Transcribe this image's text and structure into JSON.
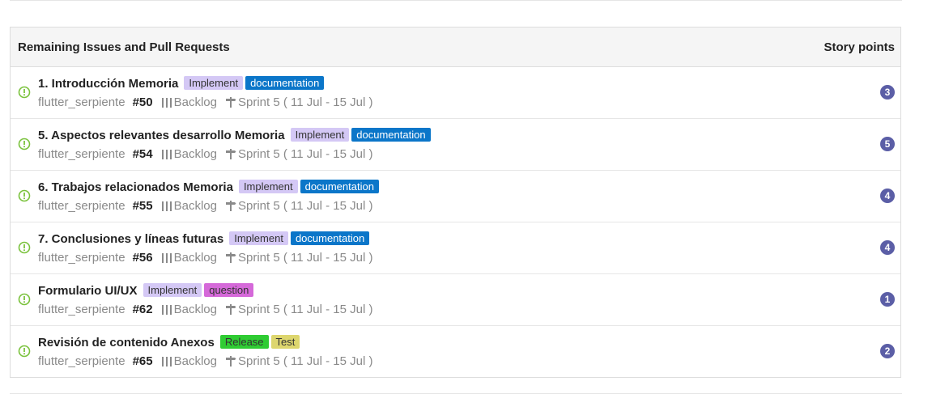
{
  "panel": {
    "header_title": "Remaining Issues and Pull Requests",
    "header_points": "Story points"
  },
  "colors": {
    "open_icon": "#7ac23c",
    "points_badge": "#5b5ea6",
    "implement_bg": "#cfc4f5",
    "documentation_bg": "#0b76c9",
    "question_bg": "#d569d9",
    "release_bg": "#2fcc33",
    "test_bg": "#ddd66e"
  },
  "issues": [
    {
      "title": "1. Introducción Memoria",
      "labels": [
        {
          "text": "Implement",
          "bg": "#d4c8f5",
          "fg": "#333333"
        },
        {
          "text": "documentation",
          "bg": "#0b76c9",
          "fg": "#ffffff"
        }
      ],
      "repo": "flutter_serpiente",
      "number": "#50",
      "status": "Backlog",
      "milestone": "Sprint 5 ( 11 Jul - 15 Jul )",
      "points": "3"
    },
    {
      "title": "5. Aspectos relevantes desarrollo Memoria",
      "labels": [
        {
          "text": "Implement",
          "bg": "#d4c8f5",
          "fg": "#333333"
        },
        {
          "text": "documentation",
          "bg": "#0b76c9",
          "fg": "#ffffff"
        }
      ],
      "repo": "flutter_serpiente",
      "number": "#54",
      "status": "Backlog",
      "milestone": "Sprint 5 ( 11 Jul - 15 Jul )",
      "points": "5"
    },
    {
      "title": "6. Trabajos relacionados Memoria",
      "labels": [
        {
          "text": "Implement",
          "bg": "#d4c8f5",
          "fg": "#333333"
        },
        {
          "text": "documentation",
          "bg": "#0b76c9",
          "fg": "#ffffff"
        }
      ],
      "repo": "flutter_serpiente",
      "number": "#55",
      "status": "Backlog",
      "milestone": "Sprint 5 ( 11 Jul - 15 Jul )",
      "points": "4"
    },
    {
      "title": "7. Conclusiones y líneas futuras",
      "labels": [
        {
          "text": "Implement",
          "bg": "#d4c8f5",
          "fg": "#333333"
        },
        {
          "text": "documentation",
          "bg": "#0b76c9",
          "fg": "#ffffff"
        }
      ],
      "repo": "flutter_serpiente",
      "number": "#56",
      "status": "Backlog",
      "milestone": "Sprint 5 ( 11 Jul - 15 Jul )",
      "points": "4"
    },
    {
      "title": "Formulario UI/UX",
      "labels": [
        {
          "text": "Implement",
          "bg": "#d4c8f5",
          "fg": "#333333"
        },
        {
          "text": "question",
          "bg": "#d569d9",
          "fg": "#333333"
        }
      ],
      "repo": "flutter_serpiente",
      "number": "#62",
      "status": "Backlog",
      "milestone": "Sprint 5 ( 11 Jul - 15 Jul )",
      "points": "1"
    },
    {
      "title": "Revisión de contenido Anexos",
      "labels": [
        {
          "text": "Release",
          "bg": "#2fcc33",
          "fg": "#333333"
        },
        {
          "text": "Test",
          "bg": "#ddd66e",
          "fg": "#333333"
        }
      ],
      "repo": "flutter_serpiente",
      "number": "#65",
      "status": "Backlog",
      "milestone": "Sprint 5 ( 11 Jul - 15 Jul )",
      "points": "2"
    }
  ]
}
